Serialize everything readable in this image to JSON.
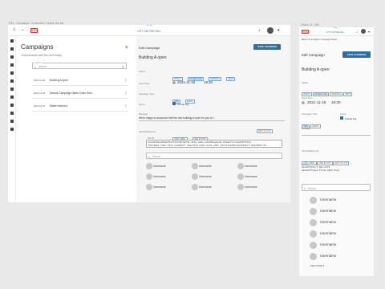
{
  "screen_caption": "ESS - Campaigns - Scheduled | Freshly new tab",
  "mobile_caption": "iPhone 14 - 456",
  "desktop": {
    "badge": "ESS",
    "logo_text": "CITY ON THE HILL",
    "left": {
      "title": "Campaigns",
      "subtitle": "Communicate with the community.",
      "search_legend": "Search",
      "search_placeholder": "Search",
      "campaigns": [
        {
          "date": "2021-11-18",
          "name": "Building A open"
        },
        {
          "date": "2021-11-19",
          "name": "Default Campaign Name Goes Here..."
        },
        {
          "date": "2021-11-15",
          "name": "Water restored"
        }
      ]
    },
    "right": {
      "heading": "Edit Campaign",
      "save_label": "SAVE CHANGES",
      "campaign_name": "Building A open",
      "status_label": "Status",
      "status_options": [
        "DRAFT",
        "SCHEDULED",
        "SENDING",
        "SENT"
      ],
      "send_time_label": "Send Time",
      "send_date": "2021-11-18",
      "send_time": "19:30",
      "campaign_type_label": "Campaign Type",
      "campaign_types": [
        "SMS",
        "EMAIL"
      ],
      "opt_in_label": "Opt-In",
      "opt_in_text": "Include Opt",
      "message_label": "Message",
      "message_text": "We're happy to announce that the new building is open for you to f...",
      "mailing_list_label": "Send Mailing List",
      "mailing_list_buttons": [
        "ADD LABEL",
        "USE IN LIST"
      ],
      "edit_list_label": "EDIT IN LIST",
      "list_id_label": "List ID",
      "list_id_lines": [
        "0e1d2791e9054279a3f137d4fb9f4e-4f8e-a8de-e8b9f8ae4e5d 9fdd477c7eda6fb5fd11",
        "f58c49bb-f8de-4fe6-ba8d5877 51ac5b74-bd04-8acd-adb2 c6fa473ad36c4aab0b5cf-9a0C9695-5b..."
      ],
      "users_search_placeholder": "Search",
      "users": [
        "Username",
        "Username",
        "Username",
        "Username",
        "Username",
        "Username",
        "Username",
        "Username",
        "Username"
      ]
    }
  },
  "mobile": {
    "badge": "ESS",
    "logo_text": "CITY ON THE HILL",
    "breadcrumb": "Back to Campaigns / Campaign Detail",
    "heading": "Edit Campaign",
    "save_label": "SAVE CHANGES",
    "campaign_name": "Building A open",
    "status_label": "Status",
    "status_options": [
      "DRAFT",
      "SCHEDULED",
      "SENDING",
      "SENT"
    ],
    "send_time_label": "Send Time",
    "send_date": "2021-11-18",
    "send_time": "19:30",
    "campaign_type_label": "Campaign Type",
    "campaign_types": [
      "SMS",
      "EMAIL"
    ],
    "opt_in_label": "Opt-In",
    "opt_in_text": "Include Opt",
    "message_label": "Message",
    "mailing_list_label": "Send Mailing List",
    "mailing_list_buttons": [
      "ADD LABEL",
      "USE IN LIST",
      "EDIT IN LIST"
    ],
    "list_id_label": "List ID",
    "list_id_lines": [
      "0e1a4f4c3d-f-60e-b678",
      "b9d4e4f7cde4-f37dd-b9d4-52ed"
    ],
    "users_search_placeholder": "Search",
    "users": [
      "Username",
      "Username",
      "Username",
      "Username",
      "Username",
      "Username"
    ],
    "see_more": "SEE MORE"
  }
}
